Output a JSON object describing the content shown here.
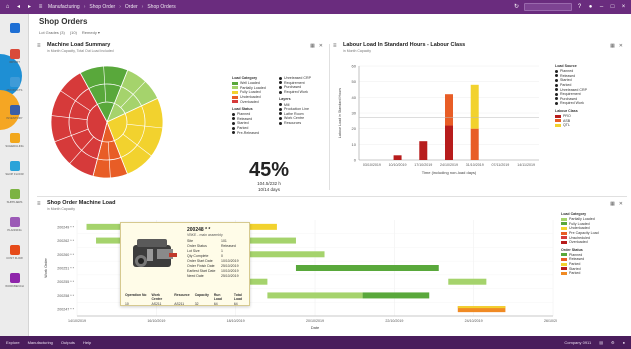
{
  "colors": {
    "brand": "#6a2c7e",
    "status_bar": "#4a1d5c",
    "red": "#d63a3a",
    "orange": "#e85d26",
    "yellow": "#f2d22e",
    "green": "#59a83b",
    "dark_green": "#2e7d32",
    "light_green": "#a5d36c",
    "dark_red": "#b71c1c"
  },
  "header": {
    "crumbs": [
      "Manufacturing",
      "Shop Order",
      "Order",
      "Shop Orders"
    ],
    "home_icon": "home-icon",
    "back_icon": "back-icon",
    "forward_icon": "forward-icon"
  },
  "page": {
    "title": "Shop Orders",
    "toolbar": [
      "Lot Grades (3)",
      "(10)",
      "Remedy ▾"
    ]
  },
  "sidebar": {
    "items": [
      {
        "label": "",
        "icon": "grid-icon",
        "color": "#1e6fd4"
      },
      {
        "label": "Import",
        "icon": "document-icon",
        "color": "#d94a3a"
      },
      {
        "label": "Products",
        "icon": "box-icon",
        "color": "#3f9bd8"
      },
      {
        "label": "Inventory",
        "icon": "barcode-icon",
        "color": "#3a5ea8"
      },
      {
        "label": "Scheduling",
        "icon": "clock-icon",
        "color": "#f2a71b"
      },
      {
        "label": "Shop Floor",
        "icon": "gear-icon",
        "color": "#2aa3d9"
      },
      {
        "label": "Suppliers",
        "icon": "globe-icon",
        "color": "#7cb342"
      },
      {
        "label": "Planning",
        "icon": "chart-icon",
        "color": "#9b59b6"
      },
      {
        "label": "Cost Flow",
        "icon": "factory-icon",
        "color": "#e64a19"
      },
      {
        "label": "Workbench",
        "icon": "circle-icon",
        "color": "#8e24aa"
      }
    ]
  },
  "machine_panel": {
    "title": "Machine Load Summary",
    "subtitle": "in Month Capacity, Total Out Load Included",
    "kpi": {
      "value": "45%",
      "line1": "104.5/232 h",
      "line2": "10/14 days"
    }
  },
  "pie_legend": {
    "category_title": "Load Category",
    "categories": [
      {
        "label": "Well Loaded",
        "color": "#59a83b"
      },
      {
        "label": "Partially Loaded",
        "color": "#a5d36c"
      },
      {
        "label": "Fully Loaded",
        "color": "#f2d22e"
      },
      {
        "label": "Underloaded",
        "color": "#e85d26"
      },
      {
        "label": "Overloaded",
        "color": "#d63a3a"
      }
    ],
    "status_title": "Load Status",
    "statuses": [
      "Planned",
      "Released",
      "Started",
      "Parked",
      "Pre-Released"
    ],
    "col2_top": [
      "Unreleased CRP",
      "Requirement",
      "Purchased",
      "Required Work"
    ],
    "layers_title": "Layers",
    "layers": [
      "Mill",
      "Production Line",
      "Lathe Room",
      "Work Centre",
      "Resources"
    ]
  },
  "labour_panel": {
    "title": "Labour Load In Standard Hours - Labour Class",
    "subtitle": "in Month Capacity",
    "xlabel": "Time (including non-load days)",
    "ylabel": "Labour Load in Standard Hours",
    "legend_title": "Load Source",
    "legend": [
      "Planned",
      "Released",
      "Started",
      "Parked",
      "Unreleased CRP",
      "Requirement",
      "Purchased",
      "Required Work"
    ],
    "class_title": "Labour Class",
    "classes": [
      {
        "label": "PRO",
        "color": "#b71c1c"
      },
      {
        "label": "ASB",
        "color": "#e85d26"
      },
      {
        "label": "QTL",
        "color": "#f2d22e"
      }
    ]
  },
  "chart_data": [
    {
      "type": "pie",
      "title": "Machine Load Summary",
      "categories": [
        "Well Loaded",
        "Partially Loaded",
        "Fully Loaded",
        "Underloaded",
        "Overloaded"
      ],
      "values": [
        14,
        12,
        26,
        10,
        38
      ]
    },
    {
      "type": "bar",
      "title": "Labour Load In Standard Hours - Labour Class",
      "ylim": [
        0,
        60
      ],
      "yticks": [
        0,
        10,
        20,
        30,
        40,
        50,
        60
      ],
      "categories": [
        "03/10/2019",
        "10/10/2019",
        "17/10/2019",
        "24/10/2019",
        "31/10/2019",
        "07/11/2019",
        "14/11/2019"
      ],
      "series": [
        {
          "name": "PRO",
          "values": [
            0,
            3,
            12,
            22,
            0,
            0,
            0
          ]
        },
        {
          "name": "ASB",
          "values": [
            0,
            0,
            0,
            20,
            20,
            0,
            0
          ]
        },
        {
          "name": "QTL",
          "values": [
            0,
            0,
            0,
            0,
            28,
            0,
            0
          ]
        }
      ]
    }
  ],
  "gantt_panel": {
    "title": "Shop Order Machine Load",
    "subtitle": "in Month Capacity",
    "ylabel": "Work Order",
    "xlabel": "Date",
    "rows": [
      "200249 * *",
      "200262 * *",
      "200260 * *",
      "200251 * *",
      "200255 * *",
      "200258 * *",
      "200247 * *"
    ],
    "xticks": [
      "14/10/2019",
      "16/10/2019",
      "18/10/2019",
      "20/10/2019",
      "22/10/2019",
      "24/10/2019",
      "26/10/2019"
    ],
    "legend_title": "Load Category",
    "legend": [
      {
        "label": "Partially Loaded",
        "color": "#a5d36c"
      },
      {
        "label": "Fully Loaded",
        "color": "#59a83b"
      },
      {
        "label": "Underloaded",
        "color": "#f2d22e"
      },
      {
        "label": "Pre Capacity Load",
        "color": "#e85d26"
      },
      {
        "label": "Unscheduled",
        "color": "#d63a3a"
      },
      {
        "label": "Overloaded",
        "color": "#b71c1c"
      }
    ],
    "status_title": "Order Status",
    "statuses": [
      {
        "label": "Planned",
        "color": "#59a83b"
      },
      {
        "label": "Released",
        "color": "#e85d26"
      },
      {
        "label": "Parked",
        "color": "#f2d22e"
      },
      {
        "label": "Started",
        "color": "#b71c1c"
      },
      {
        "label": "Parked",
        "color": "#f08a24"
      }
    ]
  },
  "tooltip": {
    "title": "200248 * *",
    "subtitle": "VBKE - main assembly",
    "rows": [
      [
        "Site",
        "101"
      ],
      [
        "Order Status",
        "Released"
      ],
      [
        "Lot Size",
        "1"
      ],
      [
        "Qty Complete",
        "0"
      ],
      [
        "Order Start Date",
        "10/10/2019"
      ],
      [
        "Order Finish Date",
        "25/10/2019"
      ],
      [
        "Earliest Start Date",
        "10/10/2019"
      ],
      [
        "Need Date",
        "25/10/2019"
      ]
    ],
    "foot_headers": [
      "Operation No",
      "Work Centre",
      "Resource",
      "Capacity",
      "Run Load",
      "Total Load"
    ],
    "foot_values": [
      "10",
      "AS211",
      "AS211",
      "32",
      "64",
      "64"
    ]
  },
  "statusbar": {
    "items": [
      "Explore",
      "Manufacturing",
      "Outputs",
      "Help"
    ],
    "company": "Company 0911",
    "right_icons": [
      "print-icon",
      "settings-icon",
      "user-icon"
    ]
  }
}
